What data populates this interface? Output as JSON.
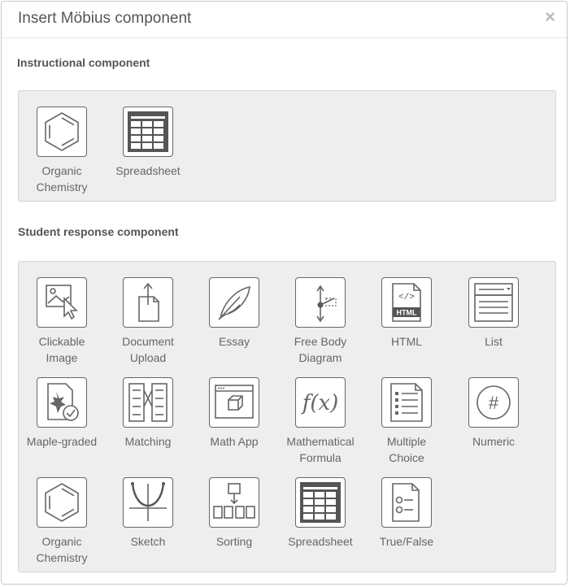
{
  "dialog": {
    "title": "Insert Möbius component",
    "close": "×"
  },
  "instructional": {
    "heading": "Instructional component",
    "items": [
      {
        "label": "Organic\nChemistry",
        "icon": "benzene-icon"
      },
      {
        "label": "Spreadsheet",
        "icon": "spreadsheet-icon"
      }
    ]
  },
  "student": {
    "heading": "Student response component",
    "items": [
      {
        "label": "Clickable\nImage",
        "icon": "clickable-image-icon"
      },
      {
        "label": "Document\nUpload",
        "icon": "document-upload-icon"
      },
      {
        "label": "Essay",
        "icon": "quill-icon"
      },
      {
        "label": "Free Body\nDiagram",
        "icon": "free-body-diagram-icon"
      },
      {
        "label": "HTML",
        "icon": "html-file-icon"
      },
      {
        "label": "List",
        "icon": "list-dropdown-icon"
      },
      {
        "label": "Maple-graded",
        "icon": "maple-graded-icon"
      },
      {
        "label": "Matching",
        "icon": "matching-icon"
      },
      {
        "label": "Math App",
        "icon": "math-app-icon"
      },
      {
        "label": "Mathematical\nFormula",
        "icon": "formula-fx-icon"
      },
      {
        "label": "Multiple\nChoice",
        "icon": "multiple-choice-icon"
      },
      {
        "label": "Numeric",
        "icon": "numeric-hash-icon"
      },
      {
        "label": "Organic\nChemistry",
        "icon": "benzene-icon"
      },
      {
        "label": "Sketch",
        "icon": "sketch-graph-icon"
      },
      {
        "label": "Sorting",
        "icon": "sorting-icon"
      },
      {
        "label": "Spreadsheet",
        "icon": "spreadsheet-icon"
      },
      {
        "label": "True/False",
        "icon": "true-false-icon"
      }
    ]
  }
}
